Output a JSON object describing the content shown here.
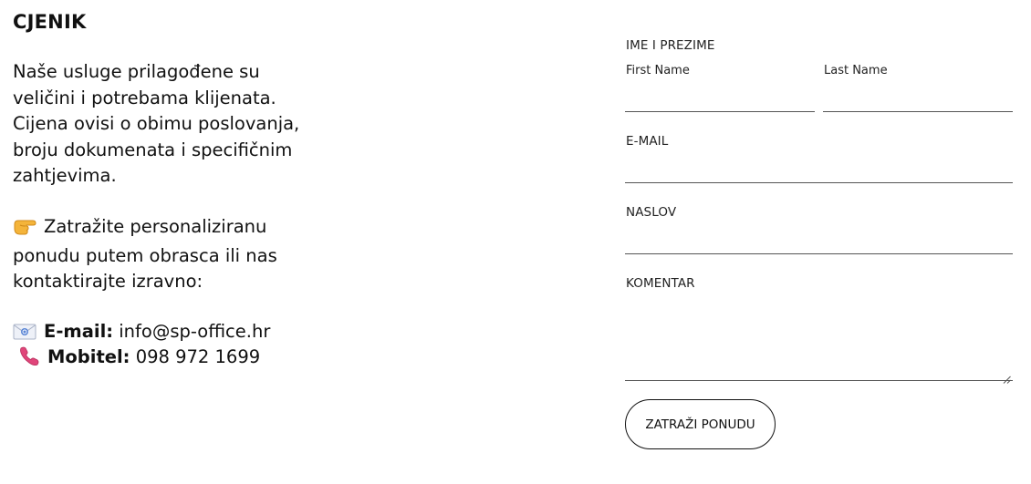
{
  "pricing": {
    "title": "CJENIK",
    "intro": "Naše usluge prilagođene su veličini i potrebama klijenata. Cijena ovisi o obimu poslovanja, broju dokumenata i specifičnim zahtjevima.",
    "cta_text": "Zatražite personaliziranu ponudu putem obrasca ili nas kontaktirajte izravno:",
    "cta_icon": "pointing-hand-icon",
    "email_label": "E-mail:",
    "email_value": "info@sp-office.hr",
    "email_icon": "envelope-icon",
    "phone_label": "Mobitel:",
    "phone_value": "098 972 1699",
    "phone_icon": "telephone-receiver-icon"
  },
  "form": {
    "name_label": "IME I PREZIME",
    "first_name_label": "First Name",
    "last_name_label": "Last Name",
    "first_name_value": "",
    "last_name_value": "",
    "email_label": "E-MAIL",
    "email_value": "",
    "subject_label": "NASLOV",
    "subject_value": "",
    "comment_label": "KOMENTAR",
    "comment_value": "",
    "submit_label": "ZATRAŽI PONUDU"
  }
}
